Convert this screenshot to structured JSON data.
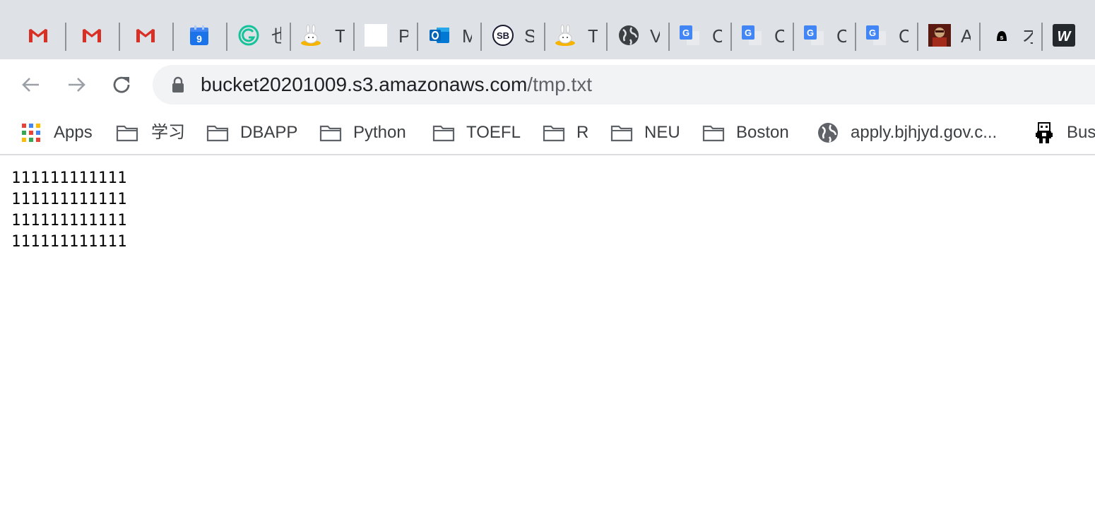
{
  "colors": {
    "tabstrip_bg": "#dee1e6",
    "omnibox_bg": "#f1f3f4",
    "gmail_red": "#d93025",
    "calendar_blue": "#1a73e8",
    "translate_blue": "#4285f4",
    "folder_gray": "#5f6368"
  },
  "tabs": [
    {
      "icon": "gmail-icon",
      "title": ""
    },
    {
      "icon": "gmail-icon",
      "title": ""
    },
    {
      "icon": "gmail-icon",
      "title": ""
    },
    {
      "icon": "calendar-icon",
      "title": "",
      "badge": "9"
    },
    {
      "icon": "grammarly-icon",
      "title": "也"
    },
    {
      "icon": "bunny-icon",
      "title": "T"
    },
    {
      "icon": "blank-page-icon",
      "title": "P"
    },
    {
      "icon": "outlook-icon",
      "title": "M"
    },
    {
      "icon": "sb-icon",
      "title": "S",
      "badge": "SB"
    },
    {
      "icon": "bunny-icon",
      "title": "T"
    },
    {
      "icon": "globe-icon",
      "title": "V"
    },
    {
      "icon": "google-translate-icon",
      "title": "C"
    },
    {
      "icon": "google-translate-icon",
      "title": "C"
    },
    {
      "icon": "google-translate-icon",
      "title": "C"
    },
    {
      "icon": "google-translate-icon",
      "title": "C"
    },
    {
      "icon": "game-avatar-icon",
      "title": "A"
    },
    {
      "icon": "dark-blob-icon",
      "title": "才",
      "badge": "s"
    },
    {
      "icon": "w-logo-icon",
      "title": "",
      "badge": "W"
    }
  ],
  "toolbar": {
    "url_host": "bucket20201009.s3.amazonaws.com",
    "url_path": "/tmp.txt"
  },
  "bookmarks": {
    "apps": "Apps",
    "folders": [
      "学习",
      "DBAPP",
      "Python",
      "TOEFL",
      "R",
      "NEU",
      "Boston"
    ],
    "link_apply": "apply.bjhjyd.gov.c...",
    "link_bus": "Bus"
  },
  "content": {
    "text": "111111111111\n111111111111\n111111111111\n111111111111"
  }
}
